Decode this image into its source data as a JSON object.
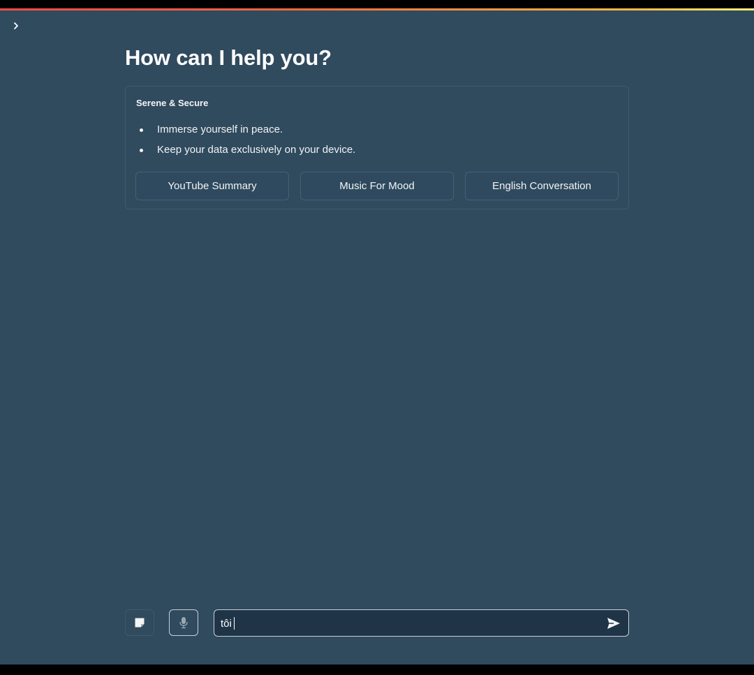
{
  "colors": {
    "background": "#304a5e",
    "text": "#ffffff",
    "accent_gradient": [
      "#ff4b4b",
      "#ffbd45",
      "#fff27a"
    ]
  },
  "sidebar": {
    "toggle_icon": "chevron-right-icon"
  },
  "main": {
    "title": "How can I help you?",
    "card": {
      "heading": "Serene & Secure",
      "bullets": [
        "Immerse yourself in peace.",
        "Keep your data exclusively on your device."
      ],
      "buttons": [
        "YouTube Summary",
        "Music For Mood",
        "English Conversation"
      ]
    }
  },
  "chat": {
    "upload_icon": "note-icon",
    "mic_icon": "microphone-icon",
    "input_value": "tôi",
    "send_icon": "send-arrow-icon"
  }
}
